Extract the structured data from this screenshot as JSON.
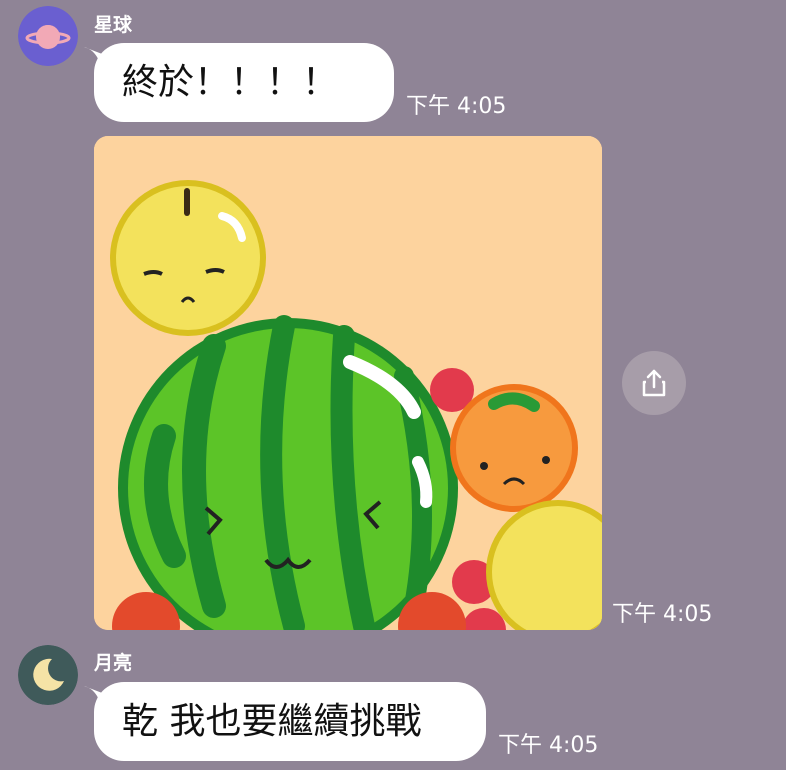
{
  "messages": [
    {
      "sender": "星球",
      "avatar_icon": "planet-icon",
      "text": "終於！！！！",
      "time": "下午 4:05"
    },
    {
      "sender": "星球",
      "type": "image",
      "image_icon": "suika-game-screenshot",
      "time": "下午 4:05"
    },
    {
      "sender": "月亮",
      "avatar_icon": "moon-icon",
      "text": "乾 我也要繼續挑戰",
      "time": "下午 4:05"
    }
  ],
  "share_icon": "share-icon",
  "colors": {
    "background": "#8f8496",
    "bubble": "#ffffff",
    "planet_avatar_bg": "#6a5fd0",
    "moon_avatar_bg": "#3f5a5a",
    "photo_bg": "#fdd39e"
  }
}
